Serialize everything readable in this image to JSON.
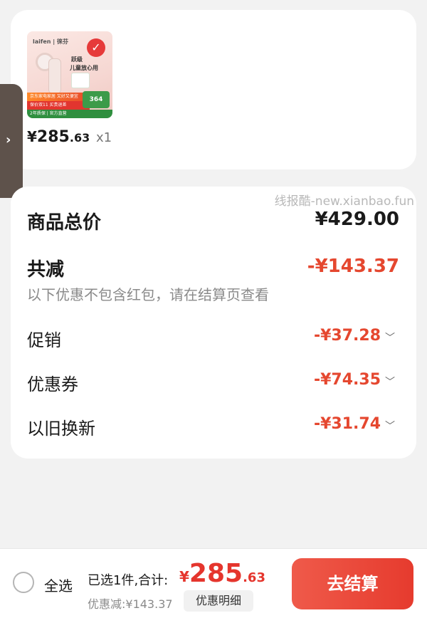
{
  "product": {
    "thumbnail": {
      "brand_text": "laifen | 徕芬",
      "headline_1": "跃级",
      "headline_2": "儿童放心用",
      "banner_1": "京东家电家居 又好又便宜",
      "banner_2": "保价双11 买贵退差",
      "banner_3": "2年质保 | 官方直营",
      "badge": "364"
    },
    "price_currency": "¥",
    "price_int": "285",
    "price_dec": ".63",
    "quantity": "x1"
  },
  "side_handle": {
    "icon": "chevron-right-icon",
    "glyph": "›"
  },
  "watermark": "线报酷-new.xianbao.fun",
  "summary": {
    "total_label": "商品总价",
    "total_value": "¥429.00",
    "reduction_label": "共减",
    "reduction_value": "-¥143.37",
    "reduction_note": "以下优惠不包含红包，请在结算页查看",
    "items": [
      {
        "label": "促销",
        "value": "-¥37.28"
      },
      {
        "label": "优惠券",
        "value": "-¥74.35"
      },
      {
        "label": "以旧换新",
        "value": "-¥31.74"
      }
    ]
  },
  "bottom": {
    "select_all": "全选",
    "selected_text": "已选1件,合计:",
    "total_currency": "¥",
    "total_int": "285",
    "total_dec": ".63",
    "discount_text": "优惠减:¥143.37",
    "detail_button": "优惠明细",
    "checkout_button": "去结算"
  },
  "colors": {
    "accent_red": "#e5472f",
    "checkout_red": "#e63b2e",
    "background": "#f2f2f2"
  }
}
